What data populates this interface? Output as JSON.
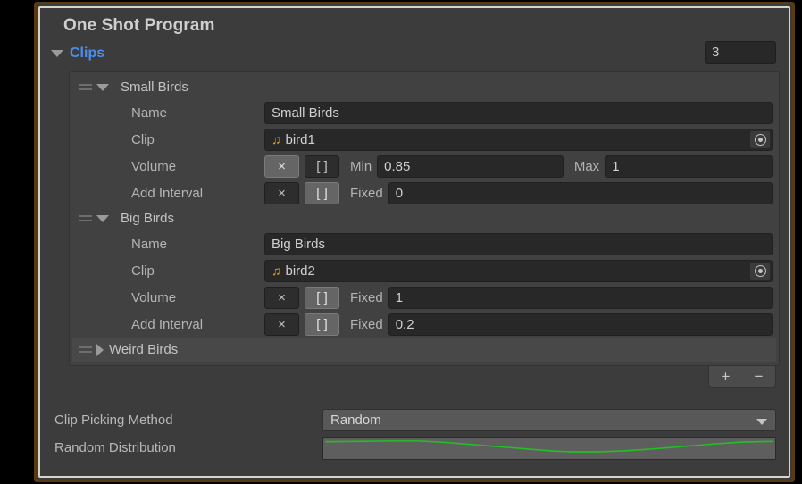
{
  "window": {
    "accent_border": "#5a3a10",
    "panel_bg": "#3c3c3c"
  },
  "header": {
    "component_title": "One Shot Program"
  },
  "clips": {
    "foldout_label": "Clips",
    "foldout_expanded": true,
    "count": "3",
    "accent_color": "#4e8ee8",
    "entries": [
      {
        "name": "Small Birds",
        "expanded": true,
        "fields": {
          "name_label": "Name",
          "name_value": "Small Birds",
          "clip_label": "Clip",
          "clip_value": "bird1",
          "clip_icon": "music-note-icon",
          "volume_label": "Volume",
          "volume_random_selected": true,
          "volume_mode_labels": [
            "Min",
            "Max"
          ],
          "volume_values": [
            "0.85",
            "1"
          ],
          "interval_label": "Add Interval",
          "interval_random_selected": false,
          "interval_mode_labels": [
            "Fixed"
          ],
          "interval_values": [
            "0"
          ]
        }
      },
      {
        "name": "Big Birds",
        "expanded": true,
        "fields": {
          "name_label": "Name",
          "name_value": "Big Birds",
          "clip_label": "Clip",
          "clip_value": "bird2",
          "clip_icon": "music-note-icon",
          "volume_label": "Volume",
          "volume_random_selected": false,
          "volume_mode_labels": [
            "Fixed"
          ],
          "volume_values": [
            "1"
          ],
          "interval_label": "Add Interval",
          "interval_random_selected": false,
          "interval_mode_labels": [
            "Fixed"
          ],
          "interval_values": [
            "0.2"
          ]
        }
      },
      {
        "name": "Weird Birds",
        "expanded": false
      }
    ],
    "toggle_x_label": "×",
    "toggle_bracket_label": "[ ]",
    "add_button_label": "+",
    "remove_button_label": "−"
  },
  "bottom": {
    "clip_picking_method_label": "Clip Picking Method",
    "clip_picking_method_value": "Random",
    "random_distribution_label": "Random Distribution",
    "curve_color": "#22c022"
  },
  "chart_data": {
    "type": "line",
    "title": "Random Distribution",
    "xlabel": "",
    "ylabel": "",
    "xlim": [
      0,
      1
    ],
    "ylim": [
      0,
      1
    ],
    "grid": false,
    "legend": "none",
    "series": [
      {
        "name": "distribution",
        "color": "#22c022",
        "x": [
          0.0,
          0.07,
          0.14,
          0.21,
          0.27,
          0.33,
          0.39,
          0.45,
          0.5,
          0.55,
          0.61,
          0.67,
          0.73,
          0.8,
          0.87,
          0.93,
          1.0
        ],
        "y": [
          0.86,
          0.88,
          0.9,
          0.9,
          0.82,
          0.7,
          0.58,
          0.46,
          0.36,
          0.3,
          0.3,
          0.36,
          0.46,
          0.6,
          0.74,
          0.84,
          0.88
        ]
      }
    ]
  }
}
